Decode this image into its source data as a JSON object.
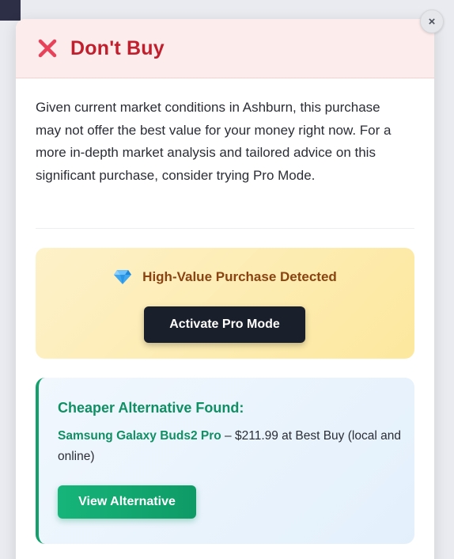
{
  "modal": {
    "title": "Don't Buy",
    "status_icon": "x-icon",
    "close_label": "×",
    "message": "Given current market conditions in Ashburn, this purchase may not offer the best value for your money right now. For a more in-depth market analysis and tailored advice on this significant purchase, consider trying Pro Mode."
  },
  "pro_box": {
    "icon": "gem-icon",
    "heading": "High-Value Purchase Detected",
    "button_label": "Activate Pro Mode"
  },
  "alternative": {
    "heading": "Cheaper Alternative Found:",
    "product_name": "Samsung Galaxy Buds2 Pro",
    "details": " – $211.99 at Best Buy (local and online)",
    "button_label": "View Alternative"
  },
  "colors": {
    "danger": "#c0202e",
    "header_bg": "#fdecec",
    "pro_text": "#8a4311",
    "pro_button": "#1a1f2c",
    "success": "#0f8f63",
    "alt_bg": "#e3f0fc"
  }
}
